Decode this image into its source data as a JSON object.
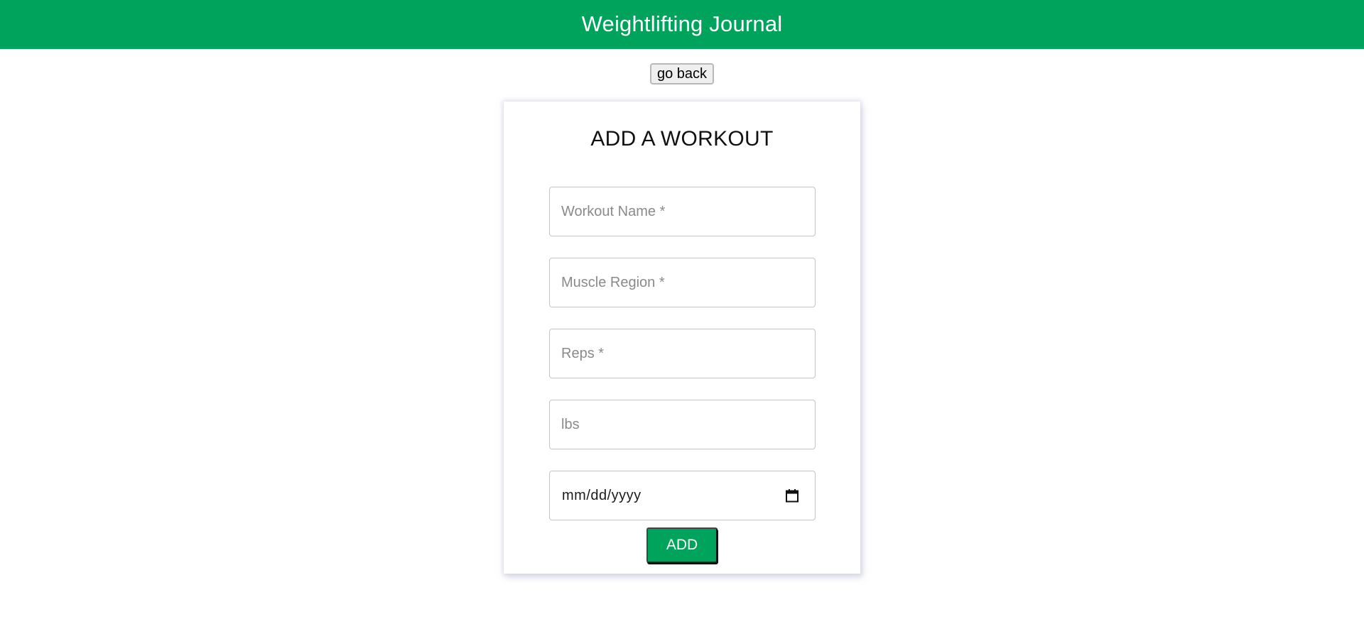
{
  "header": {
    "title": "Weightlifting Journal",
    "background_color": "#00a35c"
  },
  "nav": {
    "back_label": "go back"
  },
  "form": {
    "title": "ADD A WORKOUT",
    "fields": {
      "workout_name": {
        "placeholder": "Workout Name *",
        "value": ""
      },
      "muscle_region": {
        "placeholder": "Muscle Region *",
        "value": ""
      },
      "reps": {
        "placeholder": "Reps *",
        "value": ""
      },
      "lbs": {
        "placeholder": "lbs",
        "value": ""
      },
      "date": {
        "display": "mm/dd/yyyy",
        "icon": "calendar-icon"
      }
    },
    "submit_label": "ADD",
    "accent_color": "#00a35c"
  }
}
